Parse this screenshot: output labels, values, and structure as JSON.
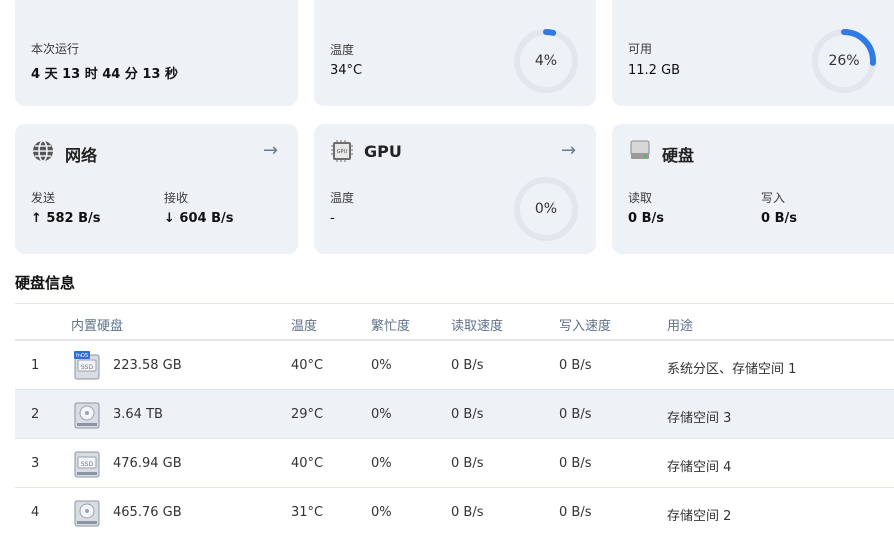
{
  "uptime": {
    "label": "本次运行",
    "value": "4 天 13 时 44 分 13 秒"
  },
  "cpu_temp": {
    "label": "温度",
    "value": "34°C",
    "percent_text": "4%",
    "percent": 4
  },
  "memory": {
    "label": "可用",
    "value": "11.2 GB",
    "percent_text": "26%",
    "percent": 26
  },
  "network": {
    "title": "网络",
    "icon": "globe-icon",
    "send_label": "发送",
    "send_value": "↑ 582 B/s",
    "recv_label": "接收",
    "recv_value": "↓ 604 B/s"
  },
  "gpu": {
    "title": "GPU",
    "icon": "gpu-chip-icon",
    "temp_label": "温度",
    "temp_value": "-",
    "percent_text": "0%",
    "percent": 0
  },
  "disk": {
    "title": "硬盘",
    "icon": "disk-icon",
    "read_label": "读取",
    "read_value": "0 B/s",
    "write_label": "写入",
    "write_value": "0 B/s"
  },
  "disk_info": {
    "title": "硬盘信息",
    "columns": [
      "内置硬盘",
      "温度",
      "繁忙度",
      "读取速度",
      "写入速度",
      "用途"
    ],
    "rows": [
      {
        "idx": "1",
        "icon": "ssd-icon",
        "badge": "fnOS",
        "size": "223.58 GB",
        "temp": "40°C",
        "busy": "0%",
        "read": "0 B/s",
        "write": "0 B/s",
        "use": "系统分区、存储空间 1"
      },
      {
        "idx": "2",
        "icon": "hdd-icon",
        "size": "3.64 TB",
        "temp": "29°C",
        "busy": "0%",
        "read": "0 B/s",
        "write": "0 B/s",
        "use": "存储空间 3"
      },
      {
        "idx": "3",
        "icon": "ssd-icon",
        "size": "476.94 GB",
        "temp": "40°C",
        "busy": "0%",
        "read": "0 B/s",
        "write": "0 B/s",
        "use": "存储空间 4"
      },
      {
        "idx": "4",
        "icon": "hdd-icon",
        "size": "465.76 GB",
        "temp": "31°C",
        "busy": "0%",
        "read": "0 B/s",
        "write": "0 B/s",
        "use": "存储空间 2"
      }
    ]
  },
  "colors": {
    "accent": "#2f7ae5",
    "track": "#e3e7ed",
    "card_bg": "#eef2f7"
  }
}
